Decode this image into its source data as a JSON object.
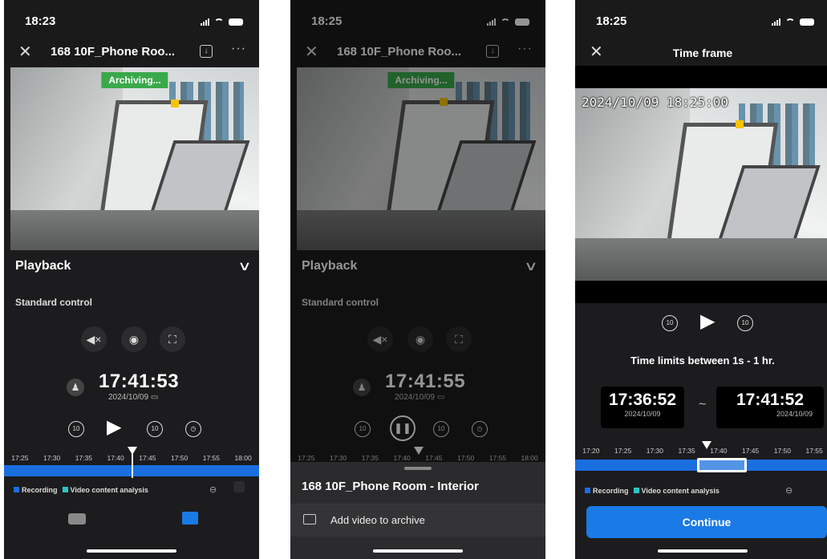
{
  "colors": {
    "accent_blue": "#1a7ae6",
    "recording": "#1a6fe0",
    "vca": "#2cc5c5",
    "archiving": "#3aa94a",
    "background": "#1c1c1e"
  },
  "screen1": {
    "status_time": "18:23",
    "nav_title": "168 10F_Phone Roo...",
    "download_icon": "download-icon",
    "more_label": "···",
    "archiving_badge": "Archiving...",
    "section_title": "Playback",
    "subsection": "Standard control",
    "current_time": "17:41:53",
    "current_date": "2024/10/09",
    "timeline_ticks": [
      "17:25",
      "17:30",
      "17:35",
      "17:40",
      "17:45",
      "17:50",
      "17:55",
      "18:00"
    ],
    "cursor_time": "17:41:53",
    "legend_recording": "Recording",
    "legend_vca": "Video content analysis",
    "tabs": [
      "live-camera-icon",
      "playback-icon"
    ],
    "active_tab": "playback-icon"
  },
  "screen2": {
    "status_time": "18:25",
    "nav_title": "168 10F_Phone Roo...",
    "archiving_badge": "Archiving...",
    "section_title": "Playback",
    "subsection": "Standard control",
    "current_time": "17:41:55",
    "current_date": "2024/10/09",
    "timeline_ticks": [
      "17:25",
      "17:30",
      "17:35",
      "17:40",
      "17:45",
      "17:50",
      "17:55",
      "18:00"
    ],
    "sheet_title": "168 10F_Phone Room - Interior",
    "sheet_item": "Add video to archive"
  },
  "screen3": {
    "status_time": "18:25",
    "nav_title": "Time frame",
    "video_timestamp": "2024/10/09 18:25:00",
    "limits_text": "Time limits between 1s - 1 hr.",
    "start_time": "17:36:52",
    "start_date": "2024/10/09",
    "separator": "~",
    "end_time": "17:41:52",
    "end_date": "2024/10/09",
    "timeline_ticks": [
      "17:20",
      "17:25",
      "17:30",
      "17:35",
      "17:40",
      "17:45",
      "17:50",
      "17:55"
    ],
    "legend_recording": "Recording",
    "legend_vca": "Video content analysis",
    "continue_label": "Continue"
  }
}
